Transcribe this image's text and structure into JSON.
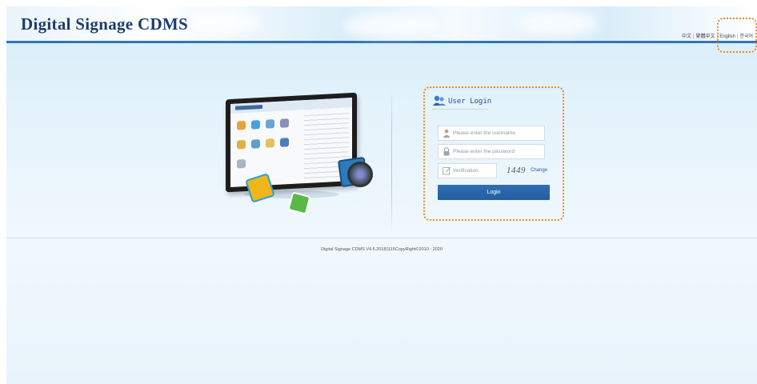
{
  "header": {
    "title": "Digital Signage CDMS",
    "languages": [
      "中文",
      "繁體中文",
      "English",
      "한국어"
    ]
  },
  "login": {
    "title": "User Login",
    "username_placeholder": "Please enter the username",
    "password_placeholder": "Please enter the password",
    "verification_placeholder": "Verification",
    "captcha_code": "1449",
    "change_label": "Change",
    "login_button": "Login"
  },
  "footer": {
    "text": "Digital Signage CDMS V4.6.20181115CopyRight©2010 - 2020"
  },
  "colors": {
    "accent": "#2e75b6",
    "button": "#235e9f",
    "highlight": "#f08a1e"
  },
  "icons": {
    "user": "user-icon",
    "lock": "lock-icon",
    "verify": "edit-icon"
  }
}
